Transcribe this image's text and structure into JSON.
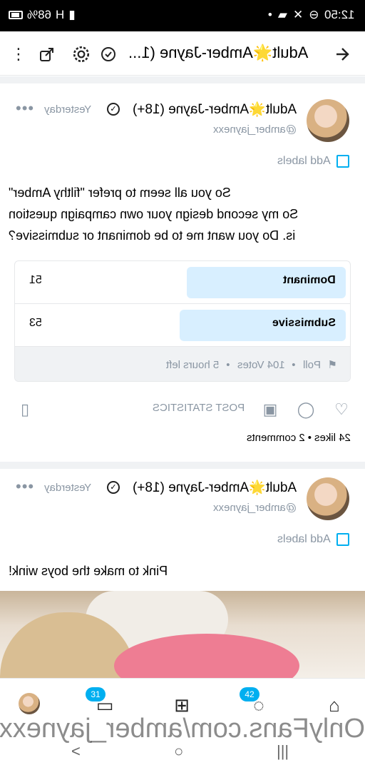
{
  "status_bar": {
    "time": "12:50",
    "battery": "68%",
    "network": "H"
  },
  "header": {
    "title": "Adult🌟Amber-Jayne (1...",
    "icons": [
      "back-arrow-icon",
      "verified-icon",
      "settings-gear-icon",
      "share-icon",
      "more-dots-icon"
    ]
  },
  "posts": [
    {
      "name": "Adult🌟Amber-Jayne (18+)",
      "handle": "@amber_jaynexx",
      "time": "Yesterday",
      "more": "•••",
      "add_labels": "Add labels",
      "text_lines": [
        "So you all seem to prefer \"filthy Amber\"",
        "So my second design your own campaign question",
        "is. Do you want me to be dominant or submissive?"
      ],
      "poll": {
        "options": [
          {
            "label": "Dominant",
            "count": "51",
            "share": 0.49
          },
          {
            "label": "Submissive",
            "count": "53",
            "share": 0.51
          }
        ],
        "footer": {
          "type": "Poll",
          "votes": "104 Votes",
          "time_left": "5 hours left",
          "separator": "•"
        }
      },
      "actions": {
        "post_statistics": "POST STATISTICS"
      },
      "likes": "24 likes",
      "comments": "2 comments",
      "separator": "•"
    },
    {
      "name": "Adult🌟Amber-Jayne (18+)",
      "handle": "@amber_jaynexx",
      "time": "Yesterday",
      "more": "•••",
      "add_labels": "Add labels",
      "text_lines": [
        "Pink to make the boys wink!"
      ]
    }
  ],
  "bottom_nav": {
    "messages_badge": "31",
    "notifications_badge": "42"
  },
  "watermark": "OnlyFans.com/amber_jaynexx",
  "colors": {
    "accent": "#00aff0",
    "poll_bar": "#d8efff",
    "muted": "#8a96a3"
  }
}
